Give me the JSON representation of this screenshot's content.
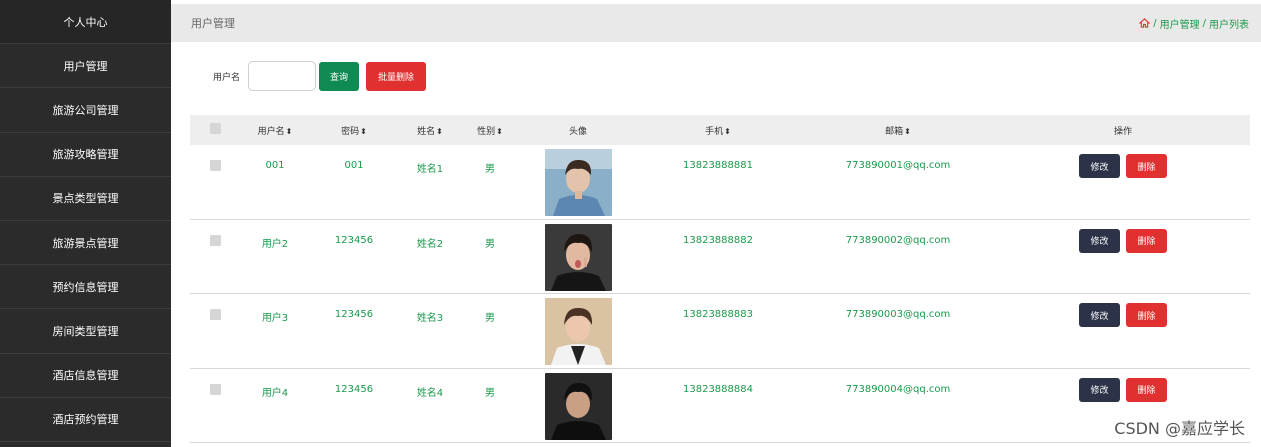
{
  "sidebar": {
    "items": [
      {
        "label": "个人中心"
      },
      {
        "label": "用户管理"
      },
      {
        "label": "旅游公司管理"
      },
      {
        "label": "旅游攻略管理"
      },
      {
        "label": "景点类型管理"
      },
      {
        "label": "旅游景点管理"
      },
      {
        "label": "预约信息管理"
      },
      {
        "label": "房间类型管理"
      },
      {
        "label": "酒店信息管理"
      },
      {
        "label": "酒店预约管理"
      }
    ]
  },
  "header": {
    "title": "用户管理",
    "breadcrumb": [
      "用户管理",
      "用户列表"
    ],
    "breadcrumb_separator": "/"
  },
  "search": {
    "label": "用户名",
    "value": "",
    "placeholder": "",
    "query_label": "查询",
    "batch_delete_label": "批量删除"
  },
  "table": {
    "columns": {
      "username": "用户名",
      "password": "密码",
      "name": "姓名",
      "gender": "性别",
      "avatar": "头像",
      "phone": "手机",
      "email": "邮箱",
      "ops": "操作"
    },
    "sort_glyph": "⬍",
    "rows": [
      {
        "username": "001",
        "password": "001",
        "name": "姓名1",
        "gender": "男",
        "phone": "13823888881",
        "email": "773890001@qq.com",
        "edit": "修改",
        "delete": "删除"
      },
      {
        "username": "用户2",
        "password": "123456",
        "name": "姓名2",
        "gender": "男",
        "phone": "13823888882",
        "email": "773890002@qq.com",
        "edit": "修改",
        "delete": "删除"
      },
      {
        "username": "用户3",
        "password": "123456",
        "name": "姓名3",
        "gender": "男",
        "phone": "13823888883",
        "email": "773890003@qq.com",
        "edit": "修改",
        "delete": "删除"
      },
      {
        "username": "用户4",
        "password": "123456",
        "name": "姓名4",
        "gender": "男",
        "phone": "13823888884",
        "email": "773890004@qq.com",
        "edit": "修改",
        "delete": "删除"
      }
    ]
  },
  "watermark": "CSDN @嘉应学长",
  "colors": {
    "sidebar_bg": "#2b2b2b",
    "accent_green": "#1a9a4b",
    "query_button": "#0f8a52",
    "danger_red": "#e0302f",
    "edit_button": "#2c3348"
  }
}
